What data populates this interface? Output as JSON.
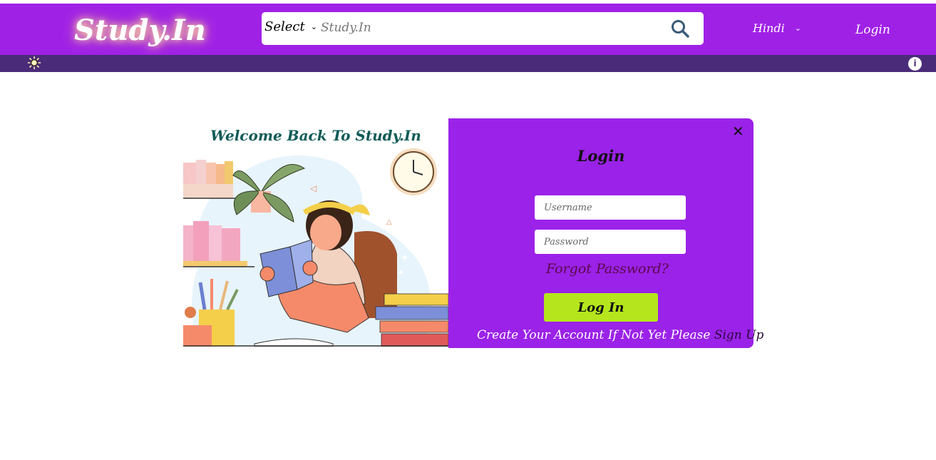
{
  "header": {
    "logo": "Study.In",
    "search": {
      "select_label": "Select",
      "placeholder": "Study.In"
    },
    "language": "Hindi",
    "login_link": "Login"
  },
  "subbar": {
    "left_icon": "sun-icon",
    "right_icon": "info-icon",
    "info_glyph": "i"
  },
  "modal": {
    "welcome_text": "Welcome Back To Study.In",
    "title": "Login",
    "close_glyph": "✕",
    "username_placeholder": "Username",
    "password_placeholder": "Password",
    "forgot_text": "Forgot Password?",
    "login_button": "Log In",
    "signup_prompt": "Create Your Account If Not Yet Please",
    "signup_link": "Sign Up"
  },
  "colors": {
    "topbar": "#a021e6",
    "subbar": "#4a2b7a",
    "panel": "#9b22e8",
    "button": "#b5e61d",
    "welcome": "#0f5b57"
  }
}
